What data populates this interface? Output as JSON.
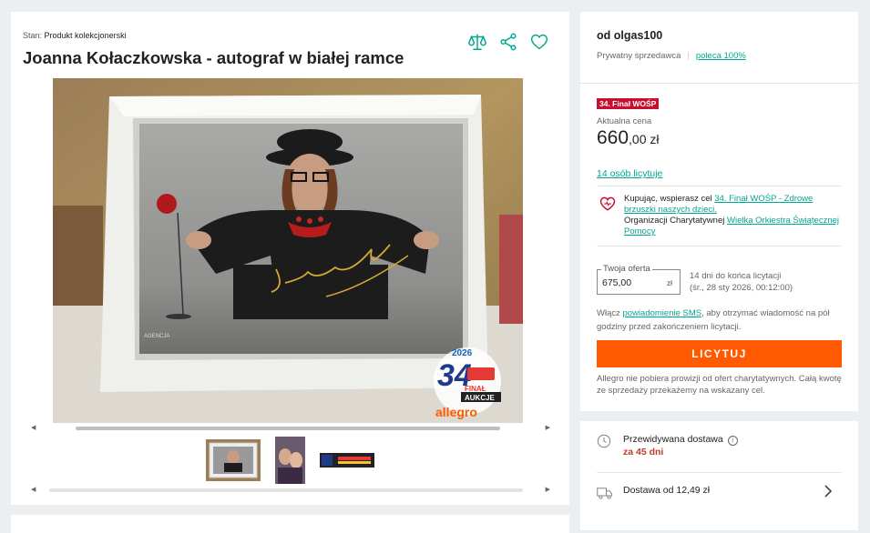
{
  "listing": {
    "condition_label": "Stan:",
    "condition_value": "Produkt kolekcjonerski",
    "title": "Joanna Kołaczkowska - autograf w białej ramce"
  },
  "seller": {
    "name": "od olgas100",
    "type": "Prywatny sprzedawca",
    "recommend": "poleca 100%"
  },
  "auction": {
    "badge": "34. Finał WOŚP",
    "price_label": "Aktualna cena",
    "price_main": "660",
    "price_fraction": ",00 zł",
    "bidders": "14 osób licytuje"
  },
  "charity": {
    "line1": "Kupując, wspierasz cel ",
    "goal_link": "34. Finał WOŚP - Zdrowe brzuszki naszych dzieci.",
    "line2": "Organizacji Charytatywnej ",
    "org_link": "Wielka Orkiestra Świątecznej Pomocy"
  },
  "offer": {
    "label": "Twoja oferta",
    "value": "675,00",
    "currency": "zł",
    "time_left": "14 dni do końca licytacji",
    "end_date": "(śr., 28 sty 2026, 00:12:00)"
  },
  "sms": {
    "before": "Włącz ",
    "link": "powiadomienie SMS",
    "after": ", aby otrzymać wiadomość na pół godziny przed zakończeniem licytacji."
  },
  "bid_button": "LICYTUJ",
  "note": "Allegro nie pobiera prowizji od ofert charytatywnych. Całą kwotę ze sprzedaży przekażemy na wskazany cel.",
  "delivery": {
    "expected_label": "Przewidywana dostawa",
    "expected_value": "za 45 dni",
    "info_icon": "i",
    "cost_label": "Dostawa od 12,49 zł"
  },
  "image_overlay": {
    "logo_number": "34",
    "logo_year": "2026",
    "logo_final": "FINAŁ",
    "logo_aukcje": "AUKCJE",
    "logo_brand": "allegro",
    "photo_agency": "AGENCJA",
    "signature": "Joanna Kołaczkowska"
  },
  "colors": {
    "accent": "#00a790",
    "bid": "#ff5a00",
    "badge": "#c8102e"
  },
  "icons": [
    "compare-icon",
    "share-icon",
    "heart-icon",
    "charity-heart-icon",
    "clock-icon",
    "truck-icon",
    "chevron-right-icon"
  ]
}
